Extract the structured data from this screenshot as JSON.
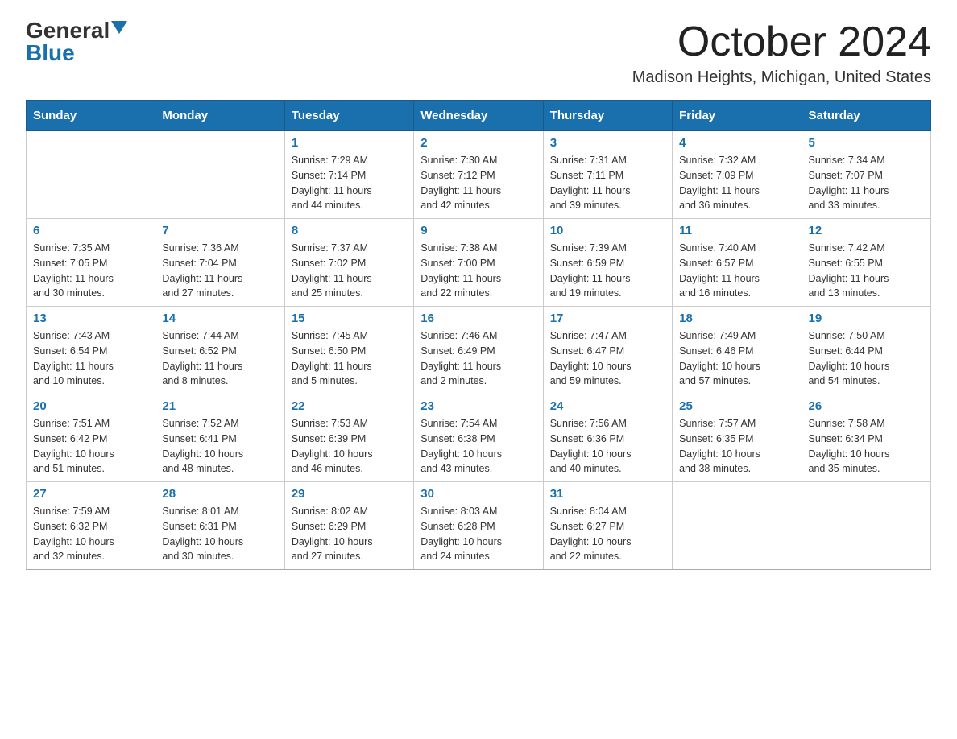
{
  "logo": {
    "general": "General",
    "blue": "Blue"
  },
  "title": "October 2024",
  "subtitle": "Madison Heights, Michigan, United States",
  "weekdays": [
    "Sunday",
    "Monday",
    "Tuesday",
    "Wednesday",
    "Thursday",
    "Friday",
    "Saturday"
  ],
  "weeks": [
    [
      {
        "day": "",
        "info": ""
      },
      {
        "day": "",
        "info": ""
      },
      {
        "day": "1",
        "info": "Sunrise: 7:29 AM\nSunset: 7:14 PM\nDaylight: 11 hours\nand 44 minutes."
      },
      {
        "day": "2",
        "info": "Sunrise: 7:30 AM\nSunset: 7:12 PM\nDaylight: 11 hours\nand 42 minutes."
      },
      {
        "day": "3",
        "info": "Sunrise: 7:31 AM\nSunset: 7:11 PM\nDaylight: 11 hours\nand 39 minutes."
      },
      {
        "day": "4",
        "info": "Sunrise: 7:32 AM\nSunset: 7:09 PM\nDaylight: 11 hours\nand 36 minutes."
      },
      {
        "day": "5",
        "info": "Sunrise: 7:34 AM\nSunset: 7:07 PM\nDaylight: 11 hours\nand 33 minutes."
      }
    ],
    [
      {
        "day": "6",
        "info": "Sunrise: 7:35 AM\nSunset: 7:05 PM\nDaylight: 11 hours\nand 30 minutes."
      },
      {
        "day": "7",
        "info": "Sunrise: 7:36 AM\nSunset: 7:04 PM\nDaylight: 11 hours\nand 27 minutes."
      },
      {
        "day": "8",
        "info": "Sunrise: 7:37 AM\nSunset: 7:02 PM\nDaylight: 11 hours\nand 25 minutes."
      },
      {
        "day": "9",
        "info": "Sunrise: 7:38 AM\nSunset: 7:00 PM\nDaylight: 11 hours\nand 22 minutes."
      },
      {
        "day": "10",
        "info": "Sunrise: 7:39 AM\nSunset: 6:59 PM\nDaylight: 11 hours\nand 19 minutes."
      },
      {
        "day": "11",
        "info": "Sunrise: 7:40 AM\nSunset: 6:57 PM\nDaylight: 11 hours\nand 16 minutes."
      },
      {
        "day": "12",
        "info": "Sunrise: 7:42 AM\nSunset: 6:55 PM\nDaylight: 11 hours\nand 13 minutes."
      }
    ],
    [
      {
        "day": "13",
        "info": "Sunrise: 7:43 AM\nSunset: 6:54 PM\nDaylight: 11 hours\nand 10 minutes."
      },
      {
        "day": "14",
        "info": "Sunrise: 7:44 AM\nSunset: 6:52 PM\nDaylight: 11 hours\nand 8 minutes."
      },
      {
        "day": "15",
        "info": "Sunrise: 7:45 AM\nSunset: 6:50 PM\nDaylight: 11 hours\nand 5 minutes."
      },
      {
        "day": "16",
        "info": "Sunrise: 7:46 AM\nSunset: 6:49 PM\nDaylight: 11 hours\nand 2 minutes."
      },
      {
        "day": "17",
        "info": "Sunrise: 7:47 AM\nSunset: 6:47 PM\nDaylight: 10 hours\nand 59 minutes."
      },
      {
        "day": "18",
        "info": "Sunrise: 7:49 AM\nSunset: 6:46 PM\nDaylight: 10 hours\nand 57 minutes."
      },
      {
        "day": "19",
        "info": "Sunrise: 7:50 AM\nSunset: 6:44 PM\nDaylight: 10 hours\nand 54 minutes."
      }
    ],
    [
      {
        "day": "20",
        "info": "Sunrise: 7:51 AM\nSunset: 6:42 PM\nDaylight: 10 hours\nand 51 minutes."
      },
      {
        "day": "21",
        "info": "Sunrise: 7:52 AM\nSunset: 6:41 PM\nDaylight: 10 hours\nand 48 minutes."
      },
      {
        "day": "22",
        "info": "Sunrise: 7:53 AM\nSunset: 6:39 PM\nDaylight: 10 hours\nand 46 minutes."
      },
      {
        "day": "23",
        "info": "Sunrise: 7:54 AM\nSunset: 6:38 PM\nDaylight: 10 hours\nand 43 minutes."
      },
      {
        "day": "24",
        "info": "Sunrise: 7:56 AM\nSunset: 6:36 PM\nDaylight: 10 hours\nand 40 minutes."
      },
      {
        "day": "25",
        "info": "Sunrise: 7:57 AM\nSunset: 6:35 PM\nDaylight: 10 hours\nand 38 minutes."
      },
      {
        "day": "26",
        "info": "Sunrise: 7:58 AM\nSunset: 6:34 PM\nDaylight: 10 hours\nand 35 minutes."
      }
    ],
    [
      {
        "day": "27",
        "info": "Sunrise: 7:59 AM\nSunset: 6:32 PM\nDaylight: 10 hours\nand 32 minutes."
      },
      {
        "day": "28",
        "info": "Sunrise: 8:01 AM\nSunset: 6:31 PM\nDaylight: 10 hours\nand 30 minutes."
      },
      {
        "day": "29",
        "info": "Sunrise: 8:02 AM\nSunset: 6:29 PM\nDaylight: 10 hours\nand 27 minutes."
      },
      {
        "day": "30",
        "info": "Sunrise: 8:03 AM\nSunset: 6:28 PM\nDaylight: 10 hours\nand 24 minutes."
      },
      {
        "day": "31",
        "info": "Sunrise: 8:04 AM\nSunset: 6:27 PM\nDaylight: 10 hours\nand 22 minutes."
      },
      {
        "day": "",
        "info": ""
      },
      {
        "day": "",
        "info": ""
      }
    ]
  ]
}
